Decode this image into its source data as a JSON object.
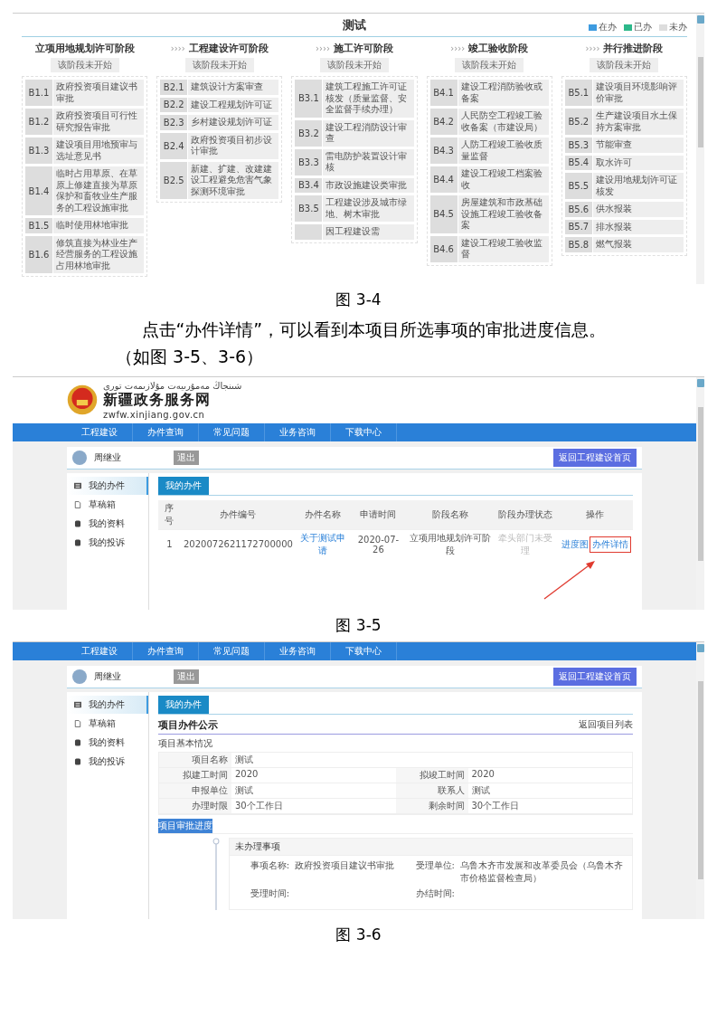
{
  "figure_3_4": {
    "title": "测试",
    "legend": [
      {
        "label": "在办",
        "color": "#3d9be0"
      },
      {
        "label": "已办",
        "color": "#2db88a"
      },
      {
        "label": "未办",
        "color": "#dddddd"
      }
    ],
    "stages": [
      {
        "name": "立项用地规划许可阶段",
        "status": "该阶段未开始",
        "items": [
          {
            "code": "B1.1",
            "text": "政府投资项目建议书审批"
          },
          {
            "code": "B1.2",
            "text": "政府投资项目可行性研究报告审批"
          },
          {
            "code": "B1.3",
            "text": "建设项目用地预审与选址意见书"
          },
          {
            "code": "B1.4",
            "text": "临时占用草原、在草原上修建直接为草原保护和畜牧业生产服务的工程设施审批"
          },
          {
            "code": "B1.5",
            "text": "临时使用林地审批"
          },
          {
            "code": "B1.6",
            "text": "修筑直接为林业生产经营服务的工程设施占用林地审批"
          }
        ]
      },
      {
        "arrow": "››››",
        "name": "工程建设许可阶段",
        "status": "该阶段未开始",
        "items": [
          {
            "code": "B2.1",
            "text": "建筑设计方案审查"
          },
          {
            "code": "B2.2",
            "text": "建设工程规划许可证"
          },
          {
            "code": "B2.3",
            "text": "乡村建设规划许可证"
          },
          {
            "code": "B2.4",
            "text": "政府投资项目初步设计审批"
          },
          {
            "code": "B2.5",
            "text": "新建、扩建、改建建设工程避免危害气象探测环境审批"
          }
        ]
      },
      {
        "arrow": "››››",
        "name": "施工许可阶段",
        "status": "该阶段未开始",
        "items": [
          {
            "code": "B3.1",
            "text": "建筑工程施工许可证核发（质量监督、安全监督手续办理）"
          },
          {
            "code": "B3.2",
            "text": "建设工程消防设计审查"
          },
          {
            "code": "B3.3",
            "text": "雷电防护装置设计审核"
          },
          {
            "code": "B3.4",
            "text": "市政设施建设类审批"
          },
          {
            "code": "B3.5",
            "text": "工程建设涉及城市绿地、树木审批"
          },
          {
            "text": "因工程建设需"
          }
        ]
      },
      {
        "arrow": "››››",
        "name": "竣工验收阶段",
        "status": "该阶段未开始",
        "items": [
          {
            "code": "B4.1",
            "text": "建设工程消防验收或备案"
          },
          {
            "code": "B4.2",
            "text": "人民防空工程竣工验收备案（市建设局）"
          },
          {
            "code": "B4.3",
            "text": "人防工程竣工验收质量监督"
          },
          {
            "code": "B4.4",
            "text": "建设工程竣工档案验收"
          },
          {
            "code": "B4.5",
            "text": "房屋建筑和市政基础设施工程竣工验收备案"
          },
          {
            "code": "B4.6",
            "text": "建设工程竣工验收监督"
          }
        ]
      },
      {
        "arrow": "››››",
        "name": "并行推进阶段",
        "status": "该阶段未开始",
        "items": [
          {
            "code": "B5.1",
            "text": "建设项目环境影响评价审批"
          },
          {
            "code": "B5.2",
            "text": "生产建设项目水土保持方案审批"
          },
          {
            "code": "B5.3",
            "text": "节能审查"
          },
          {
            "code": "B5.4",
            "text": "取水许可"
          },
          {
            "code": "B5.5",
            "text": "建设用地规划许可证核发"
          },
          {
            "code": "B5.6",
            "text": "供水报装"
          },
          {
            "code": "B5.7",
            "text": "排水报装"
          },
          {
            "code": "B5.8",
            "text": "燃气报装"
          }
        ]
      }
    ],
    "caption": "图 3-4"
  },
  "paragraph": "点击“办件详情”，可以看到本项目所选事项的审批进度信息。（如图 3-5、3-6）",
  "figure_3_5": {
    "site": {
      "uyghur": "شىنجاڭ مەمۇرىيەت مۇلازىمەت تورى",
      "name": "新疆政务服务网",
      "domain": "zwfw.xinjiang.gov.cn"
    },
    "nav": [
      "工程建设",
      "办件查询",
      "常见问题",
      "业务咨询",
      "下载中心"
    ],
    "user": {
      "name": "周继业",
      "logout": "退出",
      "home_button": "返回工程建设首页"
    },
    "sidebar": [
      {
        "label": "我的办件",
        "selected": true
      },
      {
        "label": "草稿箱",
        "selected": false
      },
      {
        "label": "我的资料",
        "selected": false
      },
      {
        "label": "我的投诉",
        "selected": false
      }
    ],
    "tabs": [
      {
        "label": "我的办件",
        "selected": true
      }
    ],
    "table": {
      "columns": [
        "序号",
        "办件编号",
        "办件名称",
        "申请时间",
        "阶段名称",
        "阶段办理状态",
        "操作"
      ],
      "rows": [
        {
          "cells": [
            {
              "kind": "text",
              "text": "1"
            },
            {
              "kind": "text",
              "text": "2020072621172700000"
            },
            {
              "kind": "link",
              "text": "关于测试申请"
            },
            {
              "kind": "text",
              "text": "2020-07-26"
            },
            {
              "kind": "text",
              "text": "立项用地规划许可阶段"
            },
            {
              "kind": "muted",
              "text": "牵头部门未受理"
            }
          ],
          "actions": [
            {
              "label": "进度图",
              "highlighted": false
            },
            {
              "label": "办件详情",
              "highlighted": true
            }
          ]
        }
      ]
    },
    "caption": "图 3-5"
  },
  "figure_3_6": {
    "nav": [
      "工程建设",
      "办件查询",
      "常见问题",
      "业务咨询",
      "下载中心"
    ],
    "user": {
      "name": "周继业",
      "logout": "退出",
      "home_button": "返回工程建设首页"
    },
    "sidebar": [
      {
        "label": "我的办件",
        "selected": true
      },
      {
        "label": "草稿箱",
        "selected": false
      },
      {
        "label": "我的资料",
        "selected": false
      },
      {
        "label": "我的投诉",
        "selected": false
      }
    ],
    "tabs": [
      {
        "label": "我的办件",
        "selected": true
      }
    ],
    "heading": "项目办件公示",
    "back_link": "返回项目列表",
    "section": "项目基本情况",
    "info_rows": [
      [
        {
          "label": "项目名称",
          "value": "测试"
        }
      ],
      [
        {
          "label": "拟建工时间",
          "value": "2020"
        },
        {
          "label": "拟竣工时间",
          "value": "2020"
        }
      ],
      [
        {
          "label": "申报单位",
          "value": "测试"
        },
        {
          "label": "联系人",
          "value": "测试"
        }
      ],
      [
        {
          "label": "办理时限",
          "value": "30个工作日"
        },
        {
          "label": "剩余时间",
          "value": "30个工作日"
        }
      ]
    ],
    "progress_heading": {
      "text": "项目审批进度",
      "selected": true
    },
    "timeline": [
      {
        "title": "未办理事项",
        "fields": [
          {
            "label": "事项名称:",
            "value": "政府投资项目建议书审批"
          },
          {
            "label": "受理单位:",
            "value": "乌鲁木齐市发展和改革委员会（乌鲁木齐市价格监督检查局）"
          },
          {
            "label": "受理时间:"
          },
          {
            "label": "办结时间:"
          }
        ]
      }
    ],
    "caption": "图 3-6"
  }
}
